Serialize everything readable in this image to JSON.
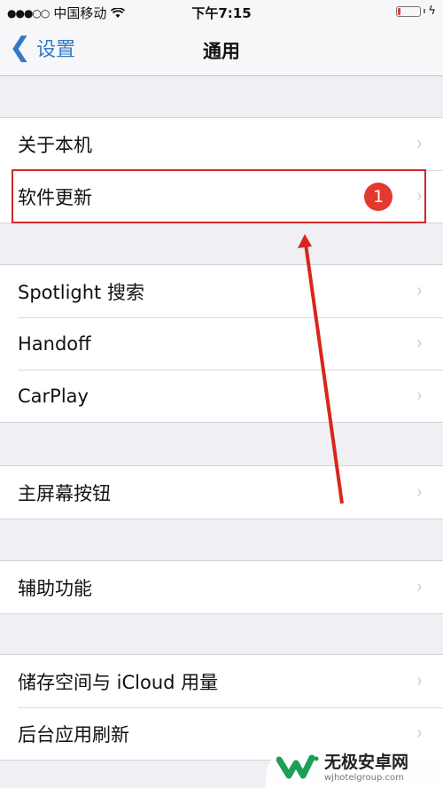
{
  "status_bar": {
    "signal": "●●●○○",
    "carrier": "中国移动",
    "wifi_icon": "wifi",
    "time": "下午7:15",
    "battery_level_percent": 10,
    "charging_icon": "ϟ"
  },
  "navbar": {
    "back_label": "设置",
    "title": "通用"
  },
  "groups": [
    {
      "rows": [
        {
          "label": "关于本机"
        },
        {
          "label": "软件更新",
          "badge": "1"
        }
      ]
    },
    {
      "rows": [
        {
          "label": "Spotlight 搜索"
        },
        {
          "label": "Handoff"
        },
        {
          "label": "CarPlay"
        }
      ]
    },
    {
      "rows": [
        {
          "label": "主屏幕按钮"
        }
      ]
    },
    {
      "rows": [
        {
          "label": "辅助功能"
        }
      ]
    },
    {
      "rows": [
        {
          "label": "储存空间与 iCloud 用量"
        },
        {
          "label": "后台应用刷新"
        }
      ]
    }
  ],
  "chevron": "›",
  "annotation": {
    "color": "#cc2a2a",
    "target": "软件更新"
  },
  "watermark": {
    "name": "无极安卓网",
    "url": "wjhotelgroup.com"
  }
}
